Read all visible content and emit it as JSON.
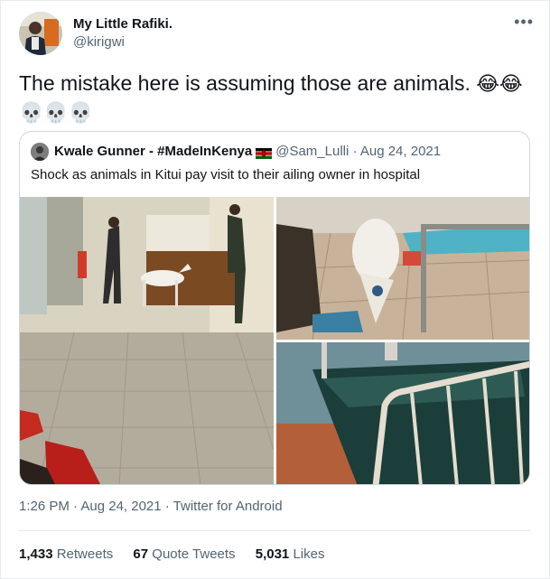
{
  "author": {
    "display_name": "My Little Rafiki.",
    "handle": "@kirigwi"
  },
  "menu_icon": "more-horizontal-icon",
  "tweet": {
    "text": "The mistake here is assuming those are animals.",
    "emojis_line1": "😂😂",
    "emojis_line2": "💀💀💀"
  },
  "quote": {
    "display_name": "Kwale Gunner - #MadeInKenya",
    "flag_icon": "kenya-flag-icon",
    "handle": "@Sam_Lulli",
    "separator": "·",
    "date": "Aug 24, 2021",
    "text": "Shock as animals in Kitui pay visit to their ailing owner in hospital",
    "media": [
      {
        "name": "photo-goat-hospital-corridor"
      },
      {
        "name": "photo-goat-by-bed"
      },
      {
        "name": "photo-green-hospital-bed"
      }
    ]
  },
  "meta": {
    "timestamp": "1:26 PM · Aug 24, 2021 · Twitter for Android"
  },
  "stats": {
    "retweets_count": "1,433",
    "retweets_label": "Retweets",
    "quotes_count": "67",
    "quotes_label": "Quote Tweets",
    "likes_count": "5,031",
    "likes_label": "Likes"
  },
  "colors": {
    "text_primary": "#0f1419",
    "text_secondary": "#536471",
    "border": "#cfd9de"
  }
}
